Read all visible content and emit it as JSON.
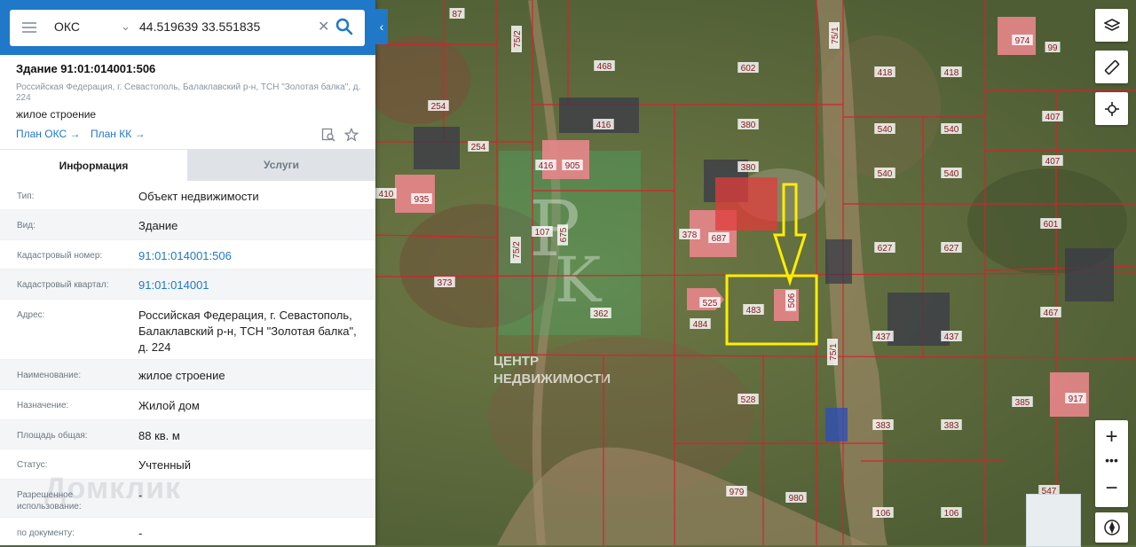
{
  "search": {
    "type": "ОКС",
    "query": "44.519639 33.551835"
  },
  "object": {
    "title": "Здание 91:01:014001:506",
    "address_short": "Российская Федерация, г. Севастополь, Балаклавский р-н, ТСН \"Золотая балка\", д. 224",
    "kind": "жилое строение",
    "plan_oks": "План ОКС →",
    "plan_kk": "План КК →"
  },
  "tabs": [
    {
      "label": "Информация"
    },
    {
      "label": "Услуги"
    }
  ],
  "info_rows": [
    {
      "label": "Тип:",
      "value": "Объект недвижимости"
    },
    {
      "label": "Вид:",
      "value": "Здание"
    },
    {
      "label": "Кадастровый номер:",
      "value": "91:01:014001:506"
    },
    {
      "label": "Кадастровый квартал:",
      "value": "91:01:014001"
    },
    {
      "label": "Адрес:",
      "value": "Российская Федерация, г. Севастополь, Балаклавский р-н, ТСН \"Золотая балка\", д. 224"
    },
    {
      "label": "Наименование:",
      "value": "жилое строение"
    },
    {
      "label": "Назначение:",
      "value": "Жилой дом"
    },
    {
      "label": "Площадь общая:",
      "value": "88 кв. м"
    },
    {
      "label": "Статус:",
      "value": "Учтенный"
    },
    {
      "label": "Разрешенное использование:",
      "value": "-"
    },
    {
      "label": "по документу:",
      "value": "-"
    }
  ],
  "watermark": "Домклик",
  "map": {
    "overlay": {
      "top": "ЦЕНТР",
      "bottom": "НЕДВИЖИМОСТИ"
    },
    "labels": [
      "87",
      "75/2",
      "468",
      "602",
      "75/1",
      "418",
      "418",
      "974",
      "99",
      "254",
      "416",
      "380",
      "540",
      "540",
      "407",
      "254",
      "416",
      "905",
      "380",
      "540",
      "540",
      "407",
      "410",
      "935",
      "107",
      "675",
      "378",
      "687",
      "627",
      "627",
      "601",
      "75/2",
      "373",
      "525",
      "483",
      "506",
      "362",
      "484",
      "437",
      "437",
      "467",
      "75/1",
      "528",
      "385",
      "917",
      "383",
      "383",
      "979",
      "980",
      "547",
      "106",
      "106"
    ]
  },
  "colors": {
    "accent": "#1f78c8",
    "parcel_line": "#d4232f",
    "building_fill": "#e8868b",
    "highlight": "#ffee00"
  }
}
